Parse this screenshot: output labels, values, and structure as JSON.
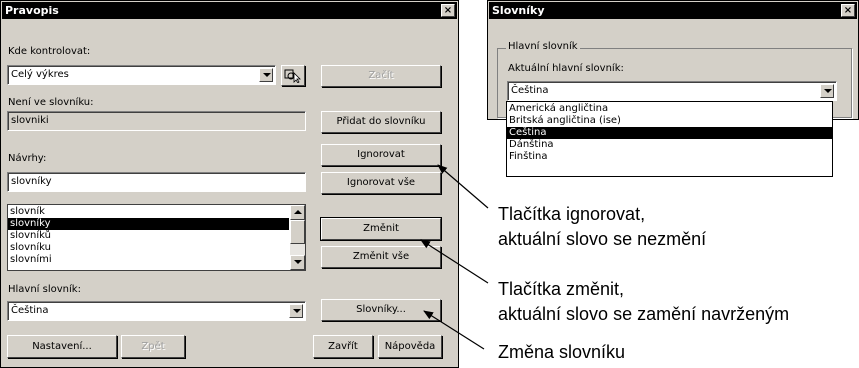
{
  "spell": {
    "title": "Pravopis",
    "close": "×",
    "check_label": "Kde kontrolovat:",
    "check_value": "Celý výkres",
    "start": "Začít",
    "not_in_dict_label": "Není ve slovníku:",
    "not_in_dict_value": "slovniki",
    "add_to_dict": "Přidat do slovníku",
    "ignore": "Ignorovat",
    "ignore_all": "Ignorovat vše",
    "suggestions_label": "Návrhy:",
    "suggestion_value": "slovníky",
    "suggestions": [
      "slovník",
      "slovníky",
      "slovníků",
      "slovníku",
      "slovními"
    ],
    "change": "Změnit",
    "change_all": "Změnit vše",
    "main_dict_label": "Hlavní slovník:",
    "main_dict_value": "Čeština",
    "dictionaries": "Slovníky...",
    "settings": "Nastavení...",
    "undo": "Zpět",
    "close_btn": "Zavřít",
    "help": "Nápověda"
  },
  "dicts": {
    "title": "Slovníky",
    "close": "×",
    "group_title": "Hlavní slovník",
    "current_label": "Aktuální hlavní slovník:",
    "current_value": "Čeština",
    "options": [
      "Americká angličtina",
      "Britská angličtina (ise)",
      "Čeština",
      "Dánština",
      "Finština"
    ]
  },
  "annotations": {
    "ignore_1": "Tlačítka ignorovat,",
    "ignore_2": "aktuální slovo se nezmění",
    "change_1": "Tlačítka změnit,",
    "change_2": "aktuální slovo se zamění navrženým",
    "dict_1": "Změna slovníku"
  }
}
